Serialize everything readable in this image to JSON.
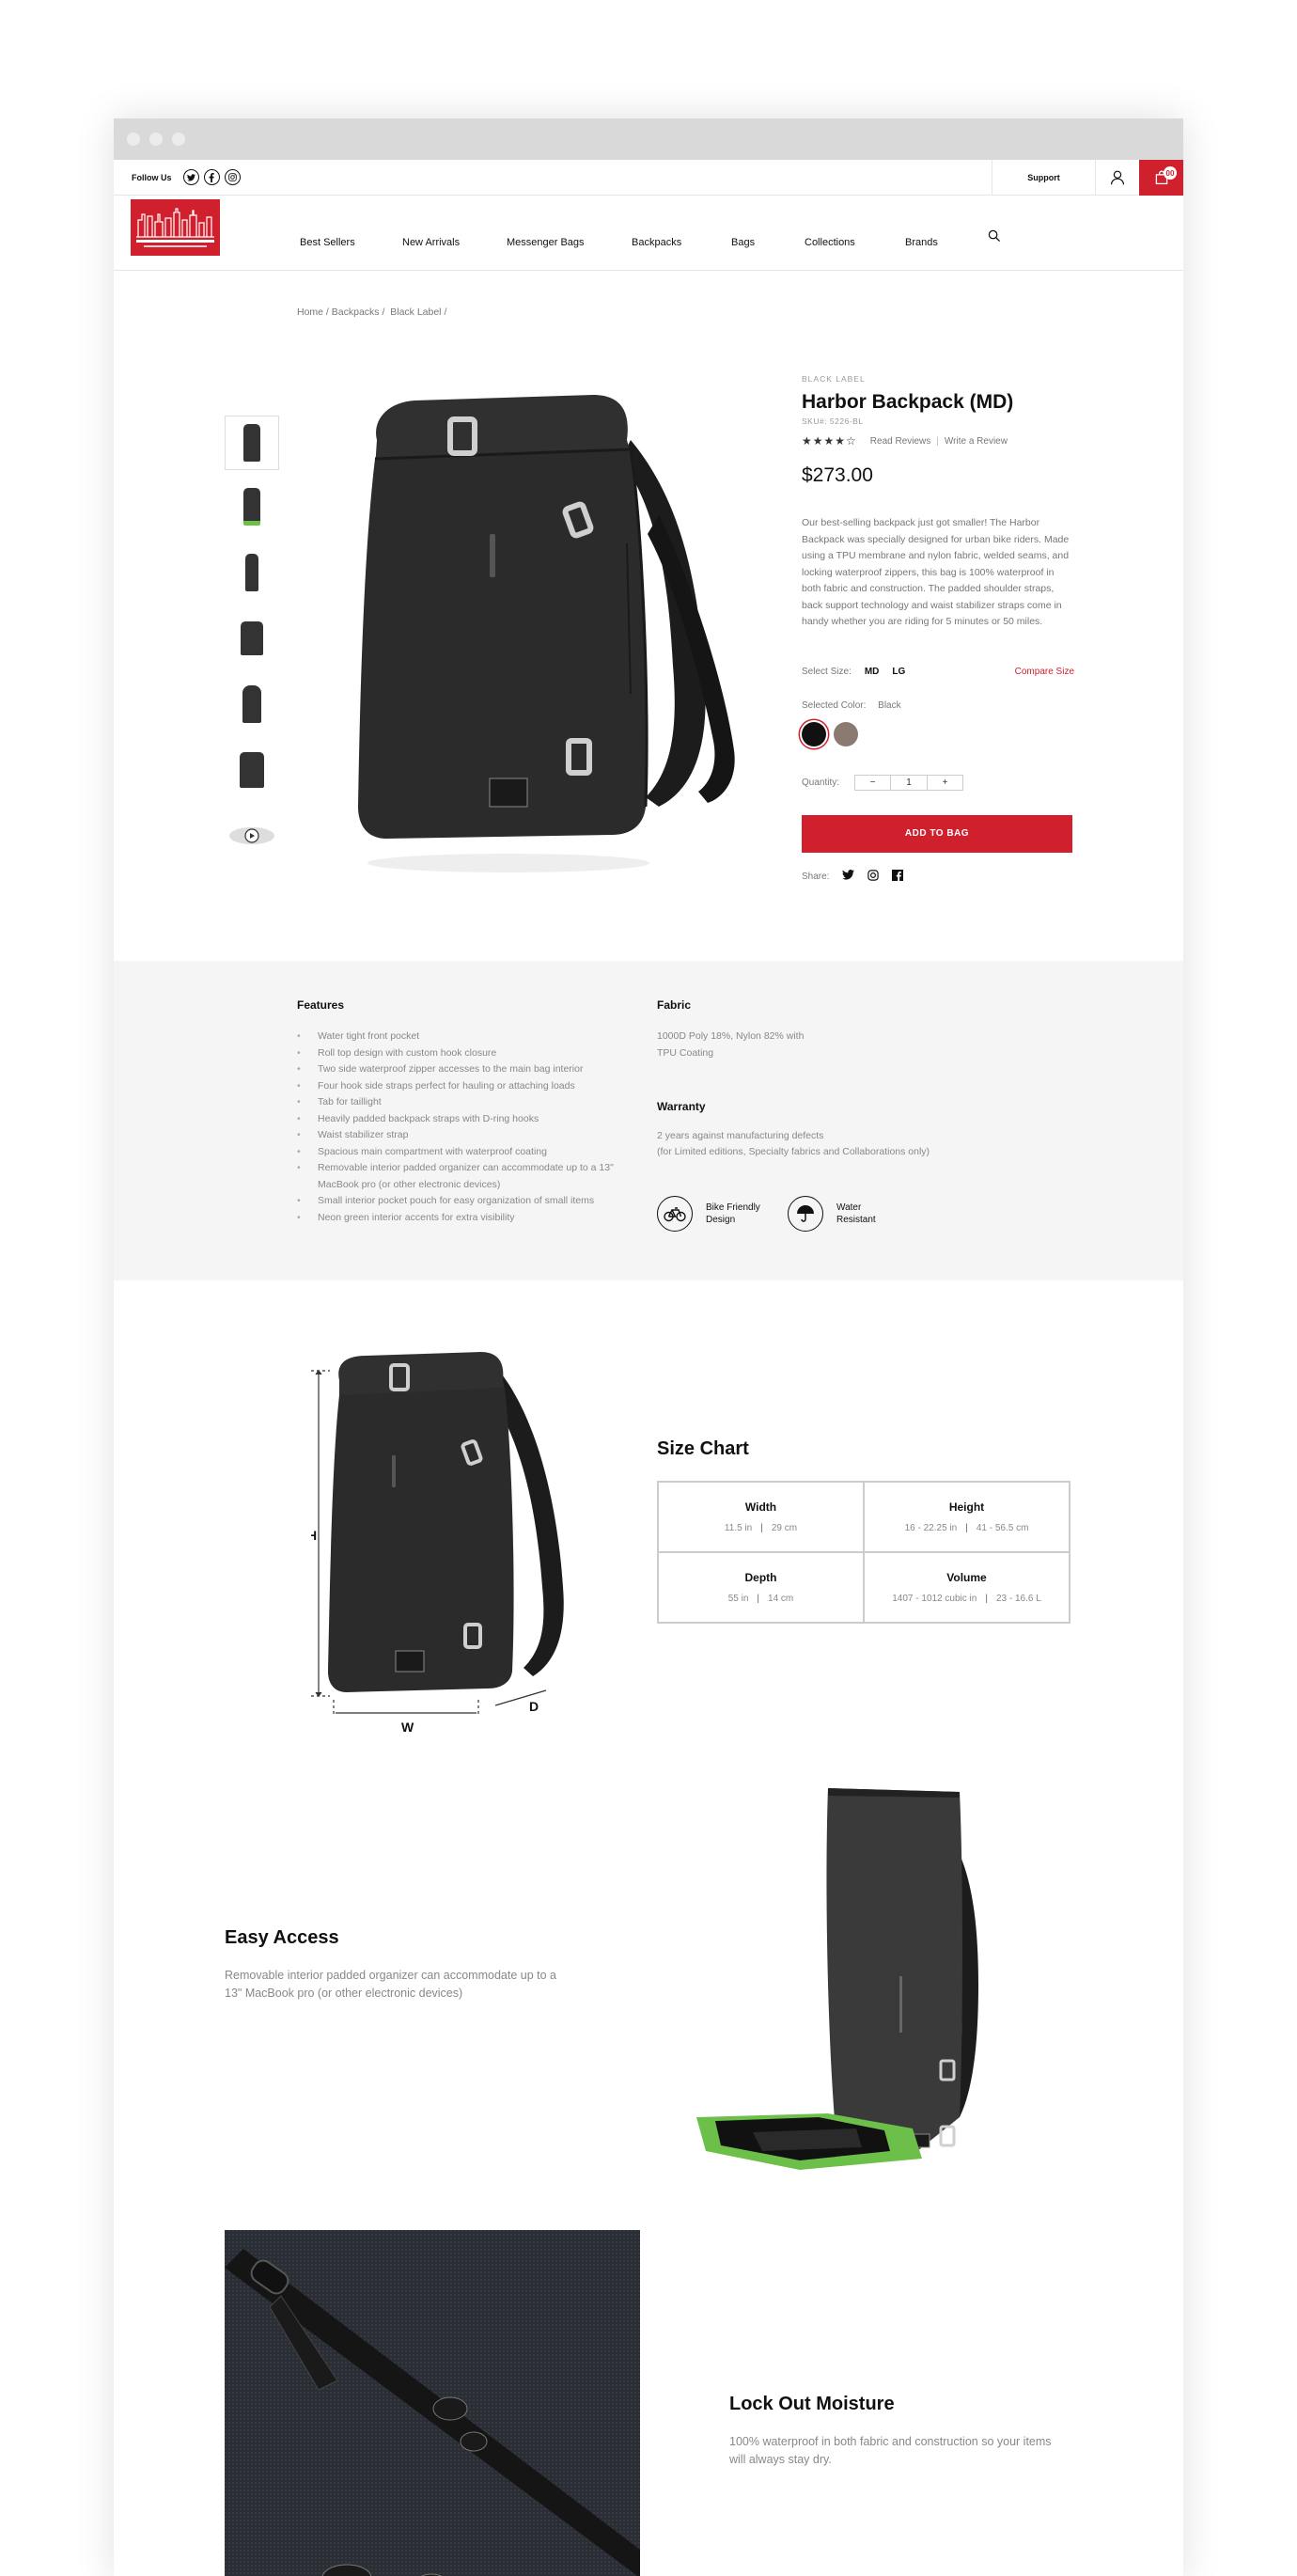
{
  "header": {
    "follow_label": "Follow Us",
    "social": [
      "twitter-icon",
      "facebook-icon",
      "instagram-icon"
    ],
    "support_label": "Support",
    "bag_count": "00"
  },
  "nav": {
    "items": [
      "Best Sellers",
      "New Arrivals",
      "Messenger Bags",
      "Backpacks",
      "Bags",
      "Collections",
      "Brands"
    ]
  },
  "breadcrumb": {
    "items": [
      "Home",
      "Backpacks",
      "Black Label"
    ]
  },
  "product": {
    "brand": "BLACK LABEL",
    "title": "Harbor Backpack (MD)",
    "sku": "SKU#: 5226-BL",
    "rating": 4,
    "read_reviews": "Read Reviews",
    "write_review": "Write a Review",
    "price": "$273.00",
    "description": "Our best-selling backpack just got smaller! The Harbor Backpack was specially designed for urban bike riders. Made using a TPU membrane and nylon fabric, welded seams, and locking waterproof zippers, this bag is 100% waterproof in both fabric and construction. The padded shoulder straps, back support technology and waist stabilizer straps come in handy whether you are riding for 5 minutes or 50 miles.",
    "size_label": "Select Size:",
    "sizes": [
      "MD",
      "LG"
    ],
    "compare_size": "Compare Size",
    "color_label": "Selected Color:",
    "color_value": "Black",
    "swatch_colors": [
      "#111111",
      "#8a7a72"
    ],
    "quantity_label": "Quantity:",
    "quantity_value": "1",
    "add_to_bag": "ADD TO BAG",
    "share_label": "Share:"
  },
  "details": {
    "features_title": "Features",
    "features": [
      "Water tight front pocket",
      "Roll top design with custom hook closure",
      "Two side waterproof zipper accesses to the main bag interior",
      "Four hook side straps perfect for hauling or attaching loads",
      "Tab for taillight",
      "Heavily padded backpack straps with D-ring hooks",
      "Waist stabilizer strap",
      "Spacious main compartment with waterproof coating",
      "Removable interior padded organizer can accommodate up to a 13\" MacBook pro (or other electronic devices)",
      "Small interior pocket pouch for easy organization of small items",
      "Neon green interior accents for extra visibility"
    ],
    "fabric_title": "Fabric",
    "fabric_text": "1000D Poly 18%, Nylon 82% with TPU Coating",
    "warranty_title": "Warranty",
    "warranty_text_1": "2 years against manufacturing defects",
    "warranty_text_2": "(for Limited editions, Specialty fabrics and Collaborations only)",
    "badges": [
      {
        "label_1": "Bike Friendly",
        "label_2": "Design",
        "icon": "bike-icon"
      },
      {
        "label_1": "Water",
        "label_2": "Resistant",
        "icon": "umbrella-icon"
      }
    ]
  },
  "size_chart": {
    "title": "Size Chart",
    "dim_labels": {
      "h": "H",
      "w": "W",
      "d": "D"
    },
    "cells": [
      {
        "title": "Width",
        "v1": "11.5 in",
        "v2": "29 cm"
      },
      {
        "title": "Height",
        "v1": "16 - 22.25 in",
        "v2": "41 - 56.5 cm"
      },
      {
        "title": "Depth",
        "v1": "55 in",
        "v2": "14 cm"
      },
      {
        "title": "Volume",
        "v1": "1407 - 1012 cubic in",
        "v2": "23 - 16.6 L"
      }
    ]
  },
  "sections": {
    "access_title": "Easy Access",
    "access_text": "Removable interior padded organizer can accommodate up to a 13\" MacBook pro (or other electronic devices)",
    "moisture_title": "Lock Out Moisture",
    "moisture_text": "100% waterproof in both fabric and construction so your items will always stay dry."
  }
}
